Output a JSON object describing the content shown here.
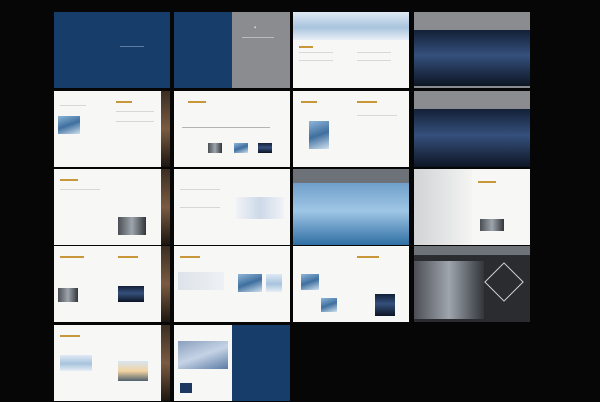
{
  "brochure": {
    "pages": [
      {
        "id": "cover"
      },
      {
        "id": "intro"
      },
      {
        "id": "contents"
      },
      {
        "id": "city-view"
      },
      {
        "id": "company"
      },
      {
        "id": "timeline"
      },
      {
        "id": "buildings"
      },
      {
        "id": "night-view"
      },
      {
        "id": "profile"
      },
      {
        "id": "map"
      },
      {
        "id": "sailing"
      },
      {
        "id": "team"
      },
      {
        "id": "service"
      },
      {
        "id": "projects"
      },
      {
        "id": "architecture"
      },
      {
        "id": "diamond"
      },
      {
        "id": "sunset"
      },
      {
        "id": "back-cover"
      }
    ]
  }
}
